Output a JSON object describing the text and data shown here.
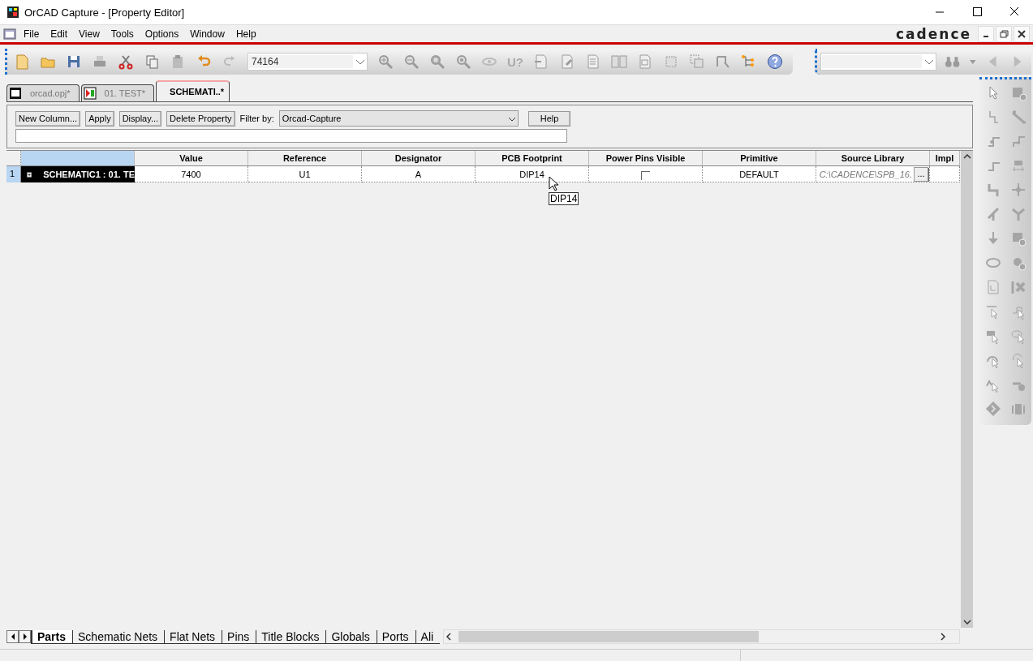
{
  "window": {
    "title": "OrCAD Capture - [Property Editor]"
  },
  "menu": [
    "File",
    "Edit",
    "View",
    "Tools",
    "Options",
    "Window",
    "Help"
  ],
  "logo": "cadence",
  "toolbar": {
    "part_combo": "74164",
    "annotate_label": "U?"
  },
  "doc_tabs": [
    {
      "label": "orcad.opj*",
      "selected": false,
      "kind": "project"
    },
    {
      "label": "01. TEST*",
      "selected": false,
      "kind": "page"
    },
    {
      "label": "SCHEMATI..*",
      "selected": true,
      "kind": "editor"
    }
  ],
  "property_editor": {
    "buttons": [
      "New Column...",
      "Apply",
      "Display...",
      "Delete Property"
    ],
    "filter_label": "Filter by:",
    "filter_value": "Orcad-Capture",
    "help_button": "Help",
    "columns": [
      "Value",
      "Reference",
      "Designator",
      "PCB Footprint",
      "Power Pins Visible",
      "Primitive",
      "Source Library",
      "Impl"
    ],
    "rows": [
      {
        "number": "1",
        "name": "SCHEMATIC1 : 01. TE",
        "selected": true,
        "cells": [
          {
            "kind": "text",
            "text": "7400"
          },
          {
            "kind": "text",
            "text": "U1"
          },
          {
            "kind": "text",
            "text": "A"
          },
          {
            "kind": "text",
            "text": "DIP14"
          },
          {
            "kind": "checkbox",
            "checked": false
          },
          {
            "kind": "text",
            "text": "DEFAULT"
          },
          {
            "kind": "path",
            "text": "C:\\CADENCE\\SPB_16.",
            "button": "..."
          }
        ]
      }
    ],
    "tooltip": "DIP14"
  },
  "sheet_tabs": [
    {
      "label": "Parts",
      "selected": true
    },
    {
      "label": "Schematic Nets",
      "selected": false
    },
    {
      "label": "Flat Nets",
      "selected": false
    },
    {
      "label": "Pins",
      "selected": false
    },
    {
      "label": "Title Blocks",
      "selected": false
    },
    {
      "label": "Globals",
      "selected": false
    },
    {
      "label": "Ports",
      "selected": false
    },
    {
      "label": "Ali",
      "selected": false
    }
  ]
}
